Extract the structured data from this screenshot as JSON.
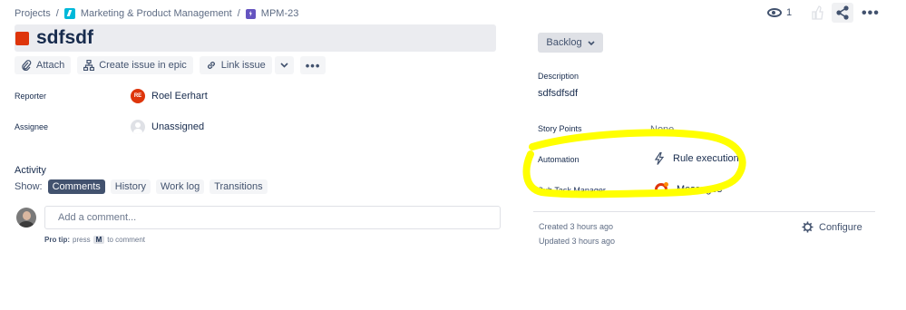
{
  "breadcrumb": {
    "projects": "Projects",
    "sep": "/",
    "project_name": "Marketing & Product Management",
    "issue_key": "MPM-23"
  },
  "header_actions": {
    "watch_count": "1"
  },
  "issue": {
    "title": "sdfsdf"
  },
  "toolbar": {
    "attach": "Attach",
    "create_issue_in_epic": "Create issue in epic",
    "link_issue": "Link issue"
  },
  "fields": {
    "reporter_label": "Reporter",
    "reporter_initials": "RE",
    "reporter_value": "Roel Eerhart",
    "assignee_label": "Assignee",
    "assignee_value": "Unassigned"
  },
  "activity": {
    "title": "Activity",
    "show_label": "Show:",
    "tabs": [
      "Comments",
      "History",
      "Work log",
      "Transitions"
    ],
    "active_tab": "Comments",
    "comment_placeholder": "Add a comment...",
    "pro_tip_bold": "Pro tip:",
    "pro_tip_press": "press",
    "pro_tip_key": "M",
    "pro_tip_rest": "to comment"
  },
  "right_panel": {
    "status": "Backlog",
    "description_label": "Description",
    "description_value": "sdfsdfsdf",
    "story_points_label": "Story Points",
    "story_points_value": "None",
    "automation_label": "Automation",
    "automation_value": "Rule executions",
    "subtask_label": "Sub Task Manager",
    "subtask_value": "Messages",
    "created": "Created 3 hours ago",
    "updated": "Updated 3 hours ago",
    "configure": "Configure"
  },
  "colors": {
    "accent": "#42526e",
    "issue_icon": "#de350b",
    "highlight": "#ffff00"
  }
}
